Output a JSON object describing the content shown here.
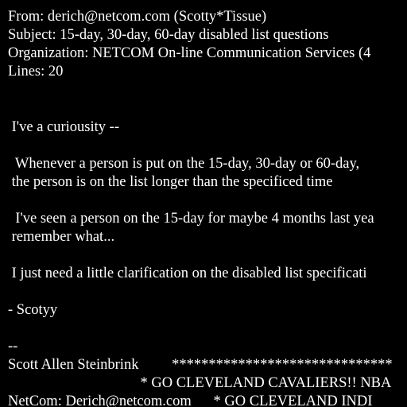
{
  "headers": {
    "from": "From: derich@netcom.com (Scotty*Tissue)",
    "subject": "Subject: 15-day, 30-day, 60-day disabled list questions",
    "organization": "Organization: NETCOM On-line Communication Services (4",
    "lines": "Lines: 20"
  },
  "body": {
    "intro": " I've a curiousity --",
    "question_line1": "  Whenever a person is put on the 15-day, 30-day or 60-day,",
    "question_line2": " the person is on the list longer than the specificed time",
    "example_line1": "  I've seen a person on the 15-day for maybe 4 months last yea",
    "example_line2": " remember what...",
    "request": " I just need a little clarification on the disabled list specificati",
    "signoff": "- Scotyy"
  },
  "signature": {
    "separator": "--",
    "name_line": "Scott Allen Steinbrink         ******************************",
    "cavaliers_line": "                                    * GO CLEVELAND CAVALIERS!! NBA",
    "netcom_line": "NetCom: Derich@netcom.com      * GO CLEVELAND INDI"
  }
}
